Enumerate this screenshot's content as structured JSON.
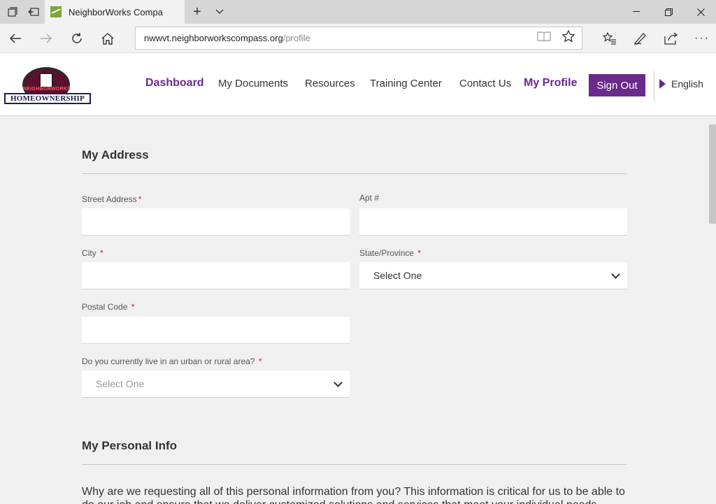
{
  "browser": {
    "tab_title": "NeighborWorks Compa",
    "url_host": "nwwvt.neighborworkscompass.org",
    "url_path": "/profile",
    "icons": [
      "tab-list-icon",
      "tab-back-icon",
      "new-tab-icon",
      "tab-dropdown-icon",
      "back-icon",
      "forward-icon",
      "refresh-icon",
      "home-icon",
      "reading-view-icon",
      "favorite-star-icon",
      "favorites-hub-icon",
      "notes-pen-icon",
      "share-icon",
      "more-icon"
    ]
  },
  "logo": {
    "top_text": "NEIGHBORWORKS",
    "band_text": "HOMEOWNERSHIP"
  },
  "nav": {
    "dashboard": "Dashboard",
    "my_documents": "My Documents",
    "resources": "Resources",
    "training_center": "Training Center",
    "contact_us": "Contact Us",
    "my_profile": "My Profile",
    "sign_out": "Sign Out",
    "language": "English"
  },
  "colors": {
    "brand_purple": "#6a2a8c",
    "required_red": "#d01c1c"
  },
  "address": {
    "title": "My Address",
    "street_label": "Street Address",
    "apt_label": "Apt #",
    "city_label": "City ",
    "state_label": "State/Province ",
    "state_value": "Select One",
    "postal_label": "Postal Code ",
    "area_label": "Do you currently live in an urban or rural area? ",
    "area_value": "Select One",
    "required_mark": "*"
  },
  "personal": {
    "title": "My Personal Info",
    "intro": "Why are we requesting all of this personal information from you? This information is critical for us to be able to do our job and ensure that we deliver customized solutions and services that meet your individual needs."
  }
}
